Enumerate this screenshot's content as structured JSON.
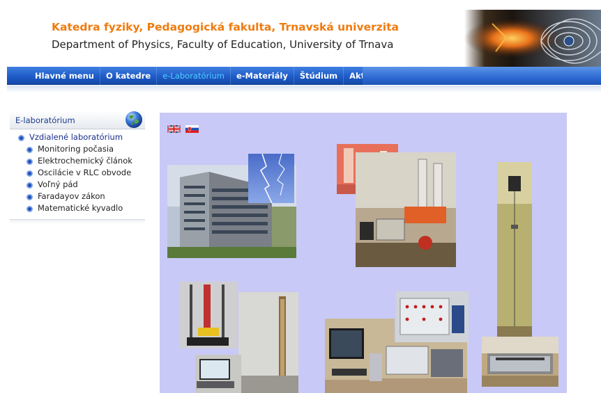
{
  "header": {
    "title_sk": "Katedra fyziky, Pedagogická fakulta, Trnavská univerzita",
    "title_en": "Department of Physics, Faculty of Education, University of Trnava"
  },
  "nav": {
    "items": [
      {
        "label": "Hlavné menu"
      },
      {
        "label": "O katedre"
      },
      {
        "label": "e-Laboratórium"
      },
      {
        "label": "e-Materiály"
      },
      {
        "label": "Štúdium"
      },
      {
        "label": "Aktivity"
      }
    ],
    "active_index": 2
  },
  "sidebar": {
    "title": "E-laboratórium",
    "parent": "Vzdialené laboratórium",
    "items": [
      {
        "label": "Monitoring počasia"
      },
      {
        "label": "Elektrochemický článok"
      },
      {
        "label": "Oscilácie v RLC obvode"
      },
      {
        "label": "Voľný pád"
      },
      {
        "label": "Faradayov zákon"
      },
      {
        "label": "Matematické kyvadlo"
      }
    ]
  },
  "content": {
    "languages": [
      "en",
      "sk"
    ]
  },
  "colors": {
    "title_orange": "#f07b0f",
    "nav_blue": "#1f5cc8",
    "nav_active": "#4fd1ff",
    "content_bg": "#c9c9f7",
    "sidebar_link": "#1a2f8c"
  }
}
